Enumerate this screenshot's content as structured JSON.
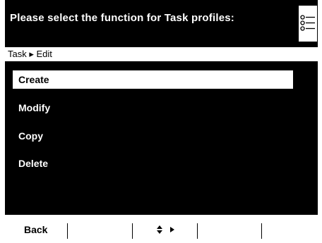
{
  "header": {
    "title": "Please select the function for Task profiles:",
    "icon": "list-icon"
  },
  "breadcrumb": {
    "text": "Task ▸ Edit"
  },
  "menu": {
    "items": [
      {
        "label": "Create",
        "selected": true
      },
      {
        "label": "Modify",
        "selected": false
      },
      {
        "label": "Copy",
        "selected": false
      },
      {
        "label": "Delete",
        "selected": false
      }
    ]
  },
  "softkeys": {
    "back_label": "Back",
    "nav_icons": [
      "up-down-arrows-icon",
      "right-arrow-icon"
    ]
  },
  "colors": {
    "background": "#000000",
    "foreground": "#ffffff"
  }
}
